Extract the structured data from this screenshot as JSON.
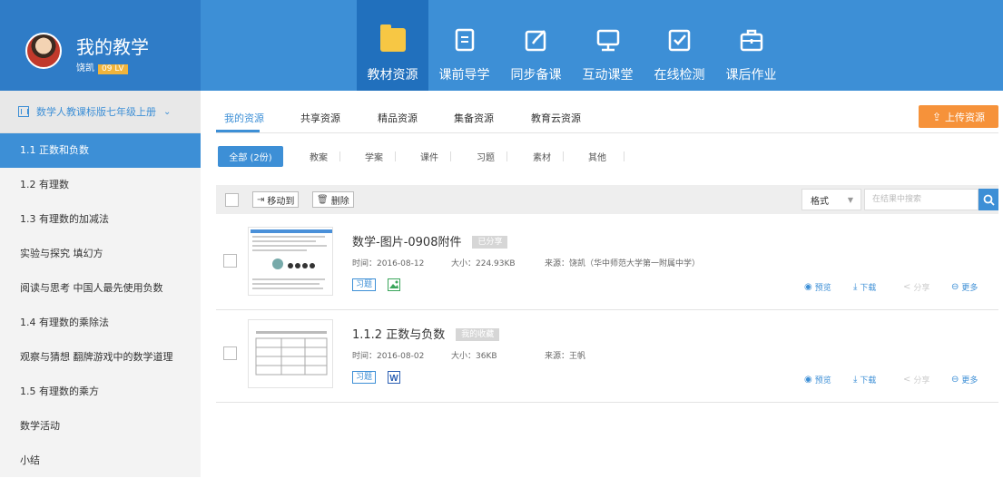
{
  "brand": {
    "title": "我的教学",
    "user": "饶凯",
    "badge": "09 LV"
  },
  "nav": [
    {
      "label": "教材资源",
      "icon": "folder-icon",
      "active": true
    },
    {
      "label": "课前导学",
      "icon": "document-icon",
      "active": false
    },
    {
      "label": "同步备课",
      "icon": "edit-icon",
      "active": false
    },
    {
      "label": "互动课堂",
      "icon": "monitor-icon",
      "active": false
    },
    {
      "label": "在线检测",
      "icon": "checkbox-icon",
      "active": false
    },
    {
      "label": "课后作业",
      "icon": "briefcase-icon",
      "active": false
    }
  ],
  "sidebar": {
    "book": "数学人教课标版七年级上册",
    "items": [
      "1.1 正数和负数",
      "1.2 有理数",
      "1.3 有理数的加减法",
      "实验与探究 填幻方",
      "阅读与思考 中国人最先使用负数",
      "1.4 有理数的乘除法",
      "观察与猜想 翻牌游戏中的数学道理",
      "1.5 有理数的乘方",
      "数学活动",
      "小结"
    ]
  },
  "tabs": [
    "我的资源",
    "共享资源",
    "精品资源",
    "集备资源",
    "教育云资源"
  ],
  "upload_label": "上传资源",
  "filters": {
    "all": "全部 (2份)",
    "items": [
      "教案",
      "学案",
      "课件",
      "习题",
      "素材",
      "其他"
    ]
  },
  "toolbar": {
    "move": "移动到",
    "delete": "删除",
    "format": "格式",
    "search_placeholder": "在结果中搜索"
  },
  "items": [
    {
      "title": "数学-图片-0908附件",
      "tag": "已分享",
      "time": "时间：2016-08-12",
      "size": "大小：224.93KB",
      "source": "来源：饶凯（华中师范大学第一附属中学）",
      "category": "习题",
      "file_type": "image-icon"
    },
    {
      "title": "1.1.2 正数与负数",
      "tag": "我的收藏",
      "time": "时间：2016-08-02",
      "size": "大小：36KB",
      "source": "来源：王帆",
      "category": "习题",
      "file_type": "word-icon"
    }
  ],
  "actions": {
    "preview": "预览",
    "download": "下载",
    "share": "分享",
    "more": "更多"
  },
  "colors": {
    "primary": "#3d8fd6",
    "header": "#3d8fd6",
    "upload": "#f6923a",
    "folder": "#f7c744"
  }
}
